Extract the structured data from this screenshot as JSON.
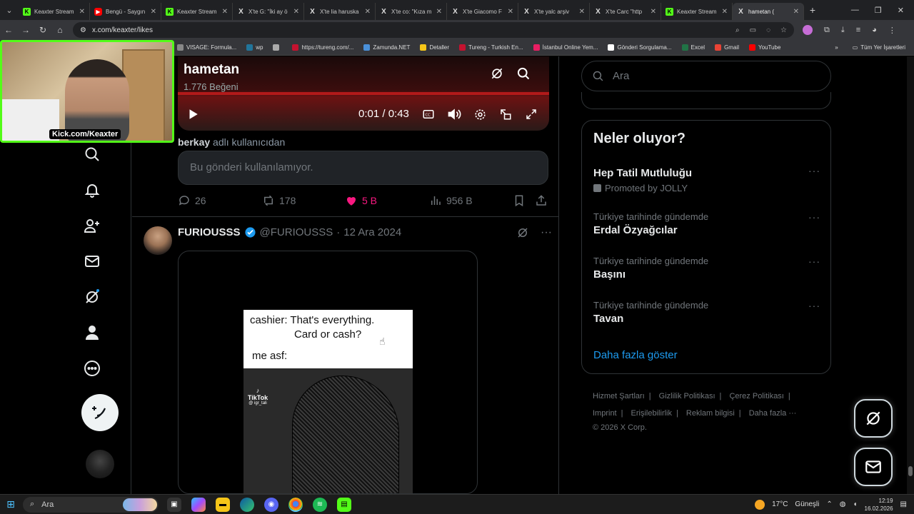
{
  "browser": {
    "tabs": [
      {
        "label": "Keaxter Stream",
        "favicon": "kick"
      },
      {
        "label": "Bengü - Saygın",
        "favicon": "youtube"
      },
      {
        "label": "Keaxter Stream",
        "favicon": "kick"
      },
      {
        "label": "X'te G: \"İki ay ö",
        "favicon": "x"
      },
      {
        "label": "X'te lia haruska",
        "favicon": "x"
      },
      {
        "label": "X'te co: \"Kıza m",
        "favicon": "x"
      },
      {
        "label": "X'te Giacomo F",
        "favicon": "x"
      },
      {
        "label": "X'te yalc arşiv",
        "favicon": "x"
      },
      {
        "label": "X'te Carc \"http",
        "favicon": "x"
      },
      {
        "label": "Keaxter Stream",
        "favicon": "kick"
      },
      {
        "label": "hametan (",
        "favicon": "x",
        "active": true
      }
    ],
    "url": "x.com/keaxter/likes",
    "bookmarks": [
      {
        "label": "VISAGE: Formula...",
        "color": "#888888"
      },
      {
        "label": "wp",
        "color": "#21759b"
      },
      {
        "label": "",
        "color": "#aaaaaa"
      },
      {
        "label": "https://tureng.com/...",
        "color": "#c4122f"
      },
      {
        "label": "Zamunda.NET",
        "color": "#4a90d9"
      },
      {
        "label": "Detaller",
        "color": "#f5c518"
      },
      {
        "label": "Tureng - Turkish En...",
        "color": "#c4122f"
      },
      {
        "label": "İstanbul Online Yem...",
        "color": "#e91e63"
      },
      {
        "label": "Gönderi Sorgulama...",
        "color": "#ffffff"
      },
      {
        "label": "Excel",
        "color": "#217346"
      },
      {
        "label": "Gmail",
        "color": "#ea4335"
      },
      {
        "label": "YouTube",
        "color": "#ff0000"
      }
    ],
    "bookmarks_all": "Tüm Yer İşaretleri"
  },
  "webcam": {
    "label": "Kick.com/Keaxter"
  },
  "video": {
    "title": "hametan",
    "likes": "1.776 Beğeni",
    "time": "0:01 / 0:43"
  },
  "quote": {
    "by_user": "berkay",
    "by_suffix": "adlı kullanıcıdan",
    "unavailable": "Bu gönderi kullanılamıyor."
  },
  "actions": {
    "replies": "26",
    "reposts": "178",
    "likes": "5 B",
    "views": "956 B"
  },
  "tweet": {
    "name": "FURIOUSSS",
    "handle": "@FURIOUSSS",
    "date": "12 Ara 2024",
    "meme_line1": "cashier: That's everything.",
    "meme_line2": "Card or cash?",
    "meme_line3": "me asf:",
    "tiktok": "TikTok",
    "tiktok_user": "@ igr_tali"
  },
  "search": {
    "placeholder": "Ara"
  },
  "trends": {
    "title": "Neler oluyor?",
    "items": [
      {
        "category": "",
        "name": "Hep Tatil Mutluluğu",
        "promoted": "Promoted by JOLLY"
      },
      {
        "category": "Türkiye tarihinde gündemde",
        "name": "Erdal Özyağcılar"
      },
      {
        "category": "Türkiye tarihinde gündemde",
        "name": "Başını"
      },
      {
        "category": "Türkiye tarihinde gündemde",
        "name": "Tavan"
      }
    ],
    "show_more": "Daha fazla göster"
  },
  "footer": {
    "links": [
      "Hizmet Şartları",
      "Gizlilik Politikası",
      "Çerez Politikası",
      "Imprint",
      "Erişilebilirlik",
      "Reklam bilgisi",
      "Daha fazla ···"
    ],
    "copyright": "© 2026 X Corp."
  },
  "taskbar": {
    "search": "Ara",
    "weather": "17°C",
    "weather_desc": "Güneşli",
    "time": "12:19",
    "date": "16.02.2026"
  },
  "colors": {
    "accent": "#1d9bf0",
    "like": "#f91880",
    "kick": "#53fc18"
  }
}
